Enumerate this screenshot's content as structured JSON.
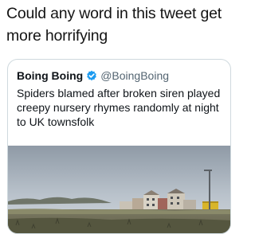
{
  "caption": {
    "text": "Could any word in this tweet get more horrifying"
  },
  "tweet": {
    "author_name": "Boing Boing",
    "author_handle": "@BoingBoing",
    "verified": true,
    "body": "Spiders blamed after broken siren played creepy nursery rhymes randomly at night to UK townsfolk"
  },
  "colors": {
    "verified_badge": "#1d9bf0",
    "handle_text": "#536471",
    "card_border": "#cfd9de"
  },
  "icons": {
    "verified": "verified-badge-icon"
  }
}
